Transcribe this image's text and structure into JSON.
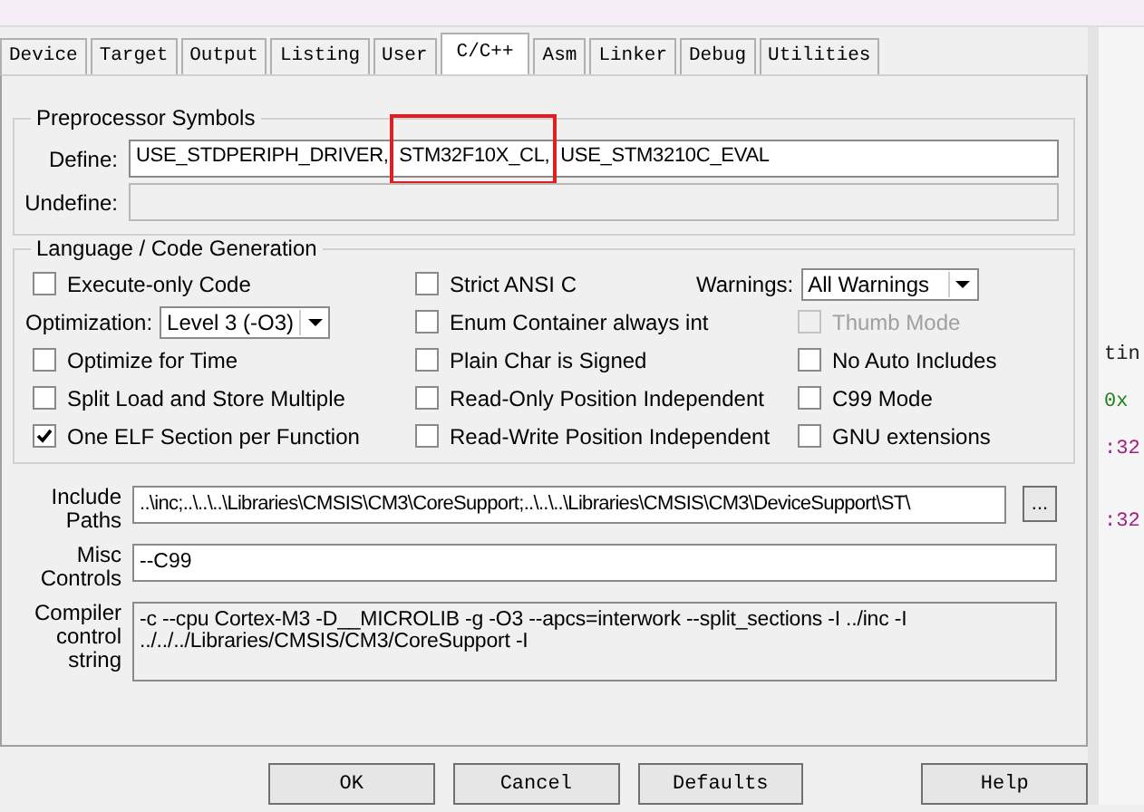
{
  "tabs": [
    {
      "label": "Device",
      "selected": false
    },
    {
      "label": "Target",
      "selected": false
    },
    {
      "label": "Output",
      "selected": false
    },
    {
      "label": "Listing",
      "selected": false
    },
    {
      "label": "User",
      "selected": false
    },
    {
      "label": "C/C++",
      "selected": true
    },
    {
      "label": "Asm",
      "selected": false
    },
    {
      "label": "Linker",
      "selected": false
    },
    {
      "label": "Debug",
      "selected": false
    },
    {
      "label": "Utilities",
      "selected": false
    }
  ],
  "preprocessor": {
    "title": "Preprocessor Symbols",
    "define": {
      "label": "Define:",
      "value": "USE_STDPERIPH_DRIVER, STM32F10X_CL, USE_STM3210C_EVAL"
    },
    "undefine": {
      "label": "Undefine:",
      "disabled": true
    }
  },
  "annotation": {
    "color": "#e02020"
  },
  "language": {
    "title": "Language / Code Generation",
    "columns": [
      [
        {
          "kind": "checkbox",
          "label": "Execute-only Code",
          "checked": false,
          "disabled": false
        },
        {
          "kind": "dropdown",
          "label": "Optimization:",
          "value": "Level 3 (-O3)"
        },
        {
          "kind": "checkbox",
          "label": "Optimize for Time",
          "checked": false,
          "disabled": false
        },
        {
          "kind": "checkbox",
          "label": "Split Load and Store Multiple",
          "checked": false,
          "disabled": false
        },
        {
          "kind": "checkbox",
          "label": "One ELF Section per Function",
          "checked": true,
          "disabled": false
        }
      ],
      [
        {
          "kind": "checkbox",
          "label": "Strict ANSI C",
          "checked": false,
          "disabled": false
        },
        {
          "kind": "checkbox",
          "label": "Enum Container always int",
          "checked": false,
          "disabled": false
        },
        {
          "kind": "checkbox",
          "label": "Plain Char is Signed",
          "checked": false,
          "disabled": false
        },
        {
          "kind": "checkbox",
          "label": "Read-Only Position Independent",
          "checked": false,
          "disabled": false
        },
        {
          "kind": "checkbox",
          "label": "Read-Write Position Independent",
          "checked": false,
          "disabled": false
        }
      ],
      [
        {
          "kind": "dropdown",
          "label": "Warnings:",
          "value": "All Warnings"
        },
        {
          "kind": "checkbox",
          "label": "Thumb Mode",
          "checked": false,
          "disabled": true
        },
        {
          "kind": "checkbox",
          "label": "No Auto Includes",
          "checked": false,
          "disabled": false
        },
        {
          "kind": "checkbox",
          "label": "C99 Mode",
          "checked": false,
          "disabled": false
        },
        {
          "kind": "checkbox",
          "label": "GNU extensions",
          "checked": false,
          "disabled": false
        }
      ]
    ]
  },
  "include_paths": {
    "label": "Include Paths",
    "value": "..\\inc;..\\..\\..\\Libraries\\CMSIS\\CM3\\CoreSupport;..\\..\\..\\Libraries\\CMSIS\\CM3\\DeviceSupport\\ST\\",
    "browse_button": "..."
  },
  "misc_controls": {
    "label": "Misc Controls",
    "value": "--C99"
  },
  "compiler_control_string": {
    "label": "Compiler control string",
    "value": "-c --cpu Cortex-M3 -D__MICROLIB -g -O3 --apcs=interwork --split_sections -I ../inc -I ../../../Libraries/CMSIS/CM3/CoreSupport -I"
  },
  "buttons": [
    "OK",
    "Cancel",
    "Defaults",
    "Help"
  ],
  "background_editor": [
    {
      "text": "tin",
      "color": "#202020"
    },
    {
      "text": "0x",
      "color": "#208020"
    },
    {
      "text": ":32",
      "color": "#a02080"
    },
    {
      "text": ":32",
      "color": "#a02080"
    }
  ]
}
